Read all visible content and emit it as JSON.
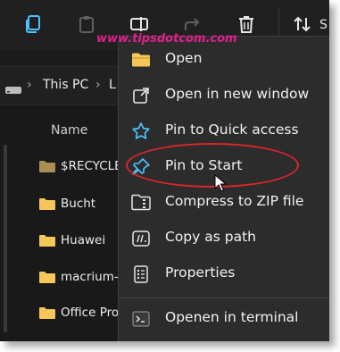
{
  "watermark": "www.tipsdotcom.com",
  "toolbar": {
    "icons": [
      "copy-icon",
      "paste-icon",
      "rename-icon",
      "share-icon",
      "delete-icon",
      "sort-icon"
    ],
    "sort_label": "S"
  },
  "addressbar": {
    "drive_icon": "drive-icon",
    "separator": "›",
    "path": [
      "This PC",
      "L"
    ]
  },
  "filelist": {
    "column_name": "Name",
    "items": [
      "$RECYCLE",
      "Bucht",
      "Huawei",
      "macrium-",
      "Office Pro"
    ]
  },
  "context_menu": {
    "items": [
      {
        "label": "Open",
        "icon": "folder-icon"
      },
      {
        "label": "Open in new window",
        "icon": "open-new-window-icon"
      },
      {
        "label": "Pin to Quick access",
        "icon": "star-icon"
      },
      {
        "label": "Pin to Start",
        "icon": "pin-icon",
        "highlighted": true
      },
      {
        "label": "Compress to ZIP file",
        "icon": "zip-icon"
      },
      {
        "label": "Copy as path",
        "icon": "copy-path-icon"
      },
      {
        "label": "Properties",
        "icon": "properties-icon"
      },
      {
        "label": "Openen in terminal",
        "icon": "terminal-icon"
      }
    ]
  },
  "colors": {
    "accent": "#4cc2ff",
    "folder": "#f5c75a",
    "annotation": "#d8262a",
    "watermark": "#e0208a"
  }
}
